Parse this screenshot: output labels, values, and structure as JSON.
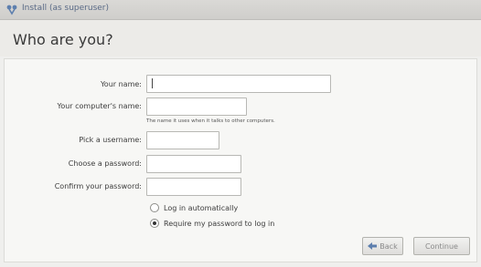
{
  "window": {
    "title": "Install (as superuser)",
    "icon": "installer-icon"
  },
  "page": {
    "title": "Who are you?"
  },
  "form": {
    "your_name_label": "Your name:",
    "your_name_value": "",
    "computer_name_label": "Your computer's name:",
    "computer_name_value": "",
    "computer_name_hint": "The name it uses when it talks to other computers.",
    "username_label": "Pick a username:",
    "username_value": "",
    "password_label": "Choose a password:",
    "password_value": "",
    "confirm_label": "Confirm your password:",
    "confirm_value": ""
  },
  "login_options": {
    "auto_label": "Log in automatically",
    "auto_selected": false,
    "require_label": "Require my password to log in",
    "require_selected": true
  },
  "buttons": {
    "back_label": "Back",
    "continue_label": "Continue"
  },
  "colors": {
    "titlebar": "#d5d4d1",
    "background": "#efefed",
    "content": "#f7f7f5"
  }
}
